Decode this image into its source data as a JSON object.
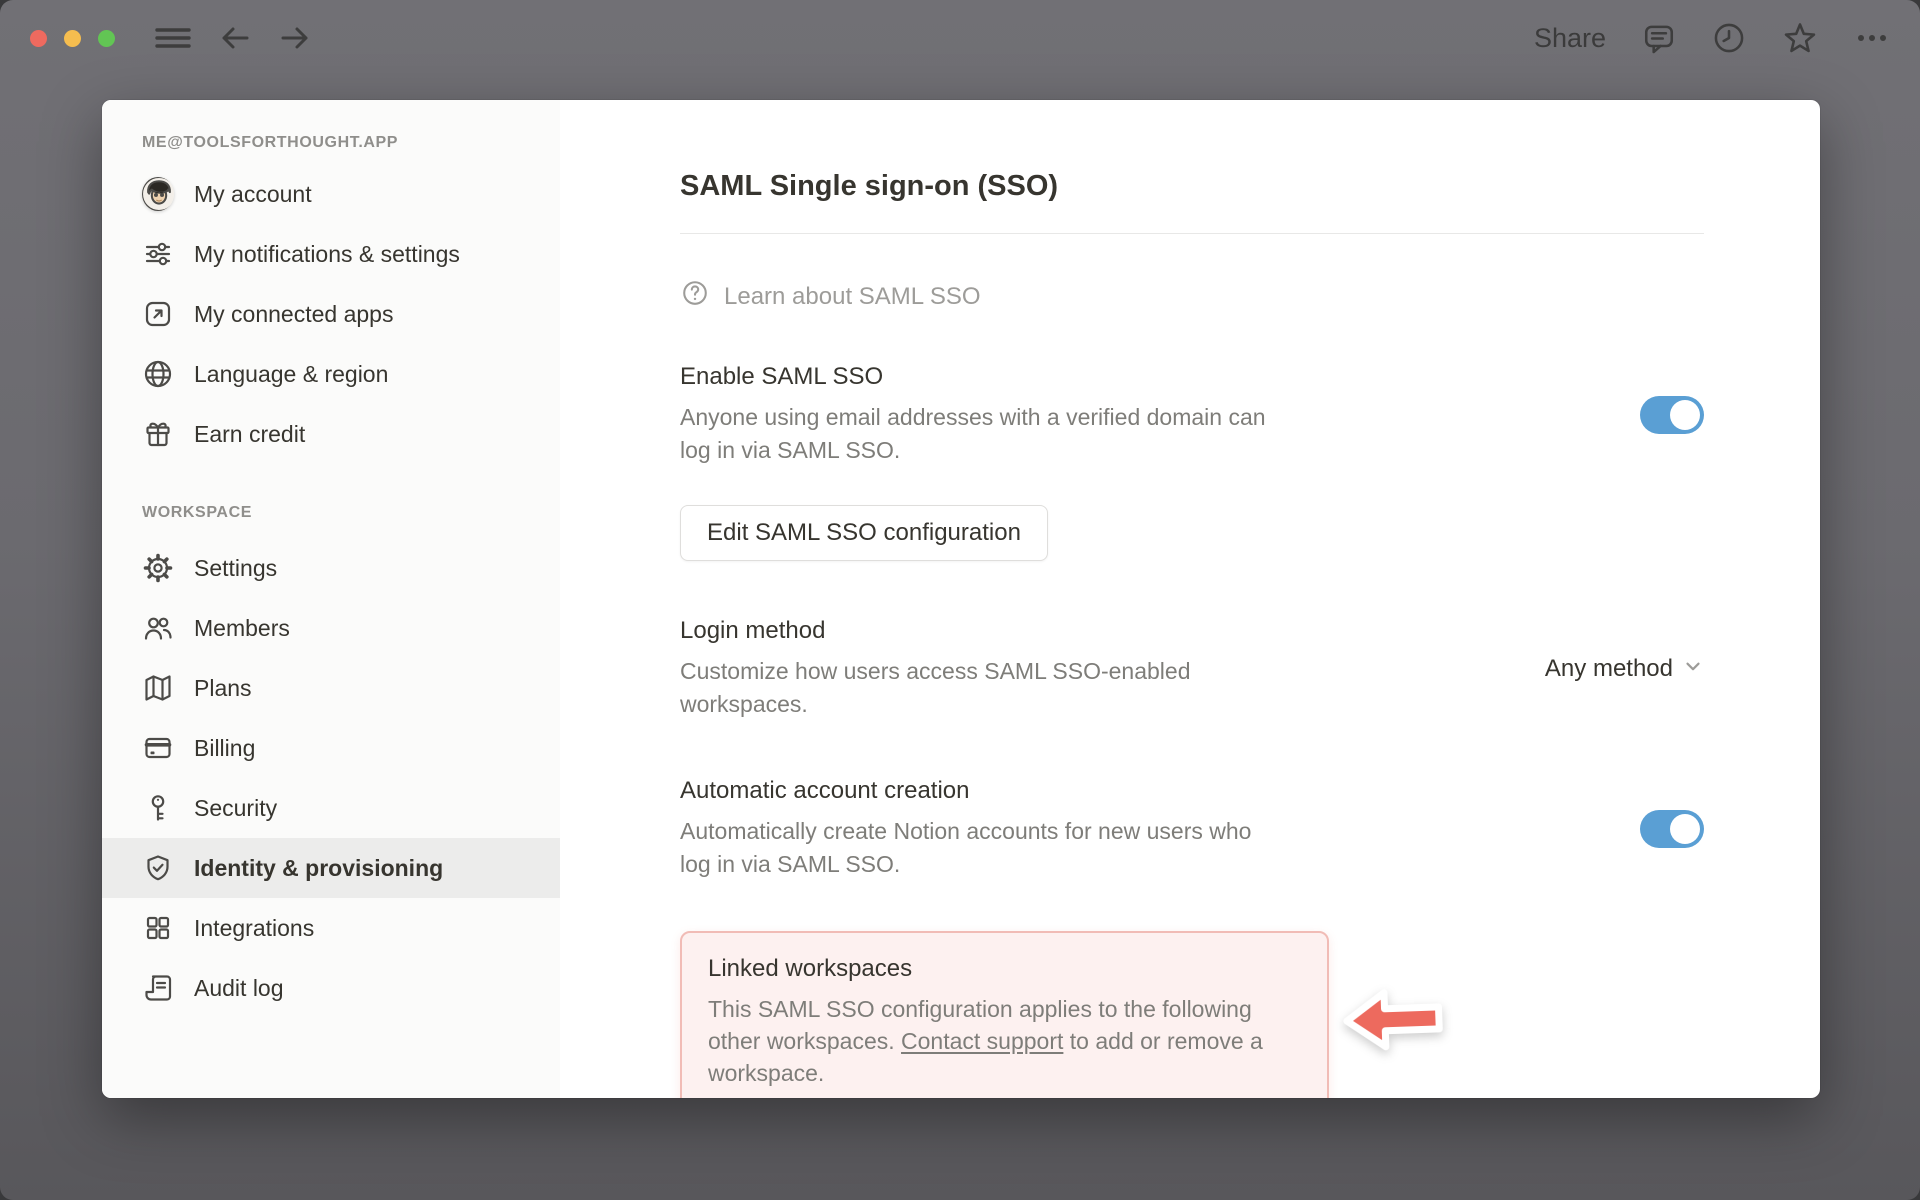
{
  "topbar": {
    "share_label": "Share"
  },
  "sidebar": {
    "account_header": "ME@TOOLSFORTHOUGHT.APP",
    "items_account": [
      {
        "label": "My account"
      },
      {
        "label": "My notifications & settings"
      },
      {
        "label": "My connected apps"
      },
      {
        "label": "Language & region"
      },
      {
        "label": "Earn credit"
      }
    ],
    "workspace_header": "WORKSPACE",
    "items_workspace": [
      {
        "label": "Settings"
      },
      {
        "label": "Members"
      },
      {
        "label": "Plans"
      },
      {
        "label": "Billing"
      },
      {
        "label": "Security"
      },
      {
        "label": "Identity & provisioning",
        "active": true
      },
      {
        "label": "Integrations"
      },
      {
        "label": "Audit log"
      }
    ]
  },
  "main": {
    "title": "SAML Single sign-on (SSO)",
    "learn_label": "Learn about SAML SSO",
    "enable": {
      "heading": "Enable SAML SSO",
      "description": "Anyone using email addresses with a verified domain can log in via SAML SSO.",
      "state": "on"
    },
    "edit_button_label": "Edit SAML SSO configuration",
    "login_method": {
      "heading": "Login method",
      "description": "Customize how users access SAML SSO-enabled workspaces.",
      "selected": "Any method"
    },
    "auto_account": {
      "heading": "Automatic account creation",
      "description": "Automatically create Notion accounts for new users who log in via SAML SSO.",
      "state": "on"
    },
    "linked_workspaces": {
      "heading": "Linked workspaces",
      "text_before_link": "This SAML SSO configuration applies to the following other workspaces. ",
      "link_label": "Contact support",
      "text_after_link": " to add or remove a workspace."
    }
  },
  "colors": {
    "toggle_on": "#5a9fd4",
    "annotation_red": "#ed6a5e",
    "callout_bg": "#fdf1f0",
    "callout_border": "#f1bcb6",
    "traffic_red": "#ee6a5f",
    "traffic_yellow": "#f5bd4f",
    "traffic_green": "#62c554"
  }
}
